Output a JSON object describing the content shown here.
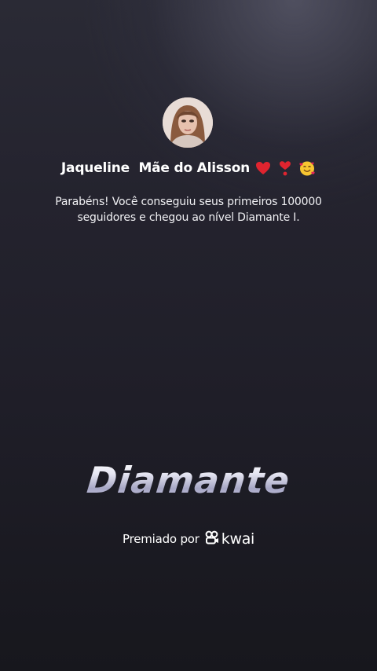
{
  "profile": {
    "name": "Jaqueline  Mãe do Alisson",
    "name_emojis": [
      "red-heart",
      "heart-exclamation",
      "smiling-face-with-hearts"
    ]
  },
  "message": {
    "line1": "Parabéns! Você conseguiu seus primeiros 100000",
    "line2": "seguidores e chegou ao nível Diamante I."
  },
  "level": {
    "title": "Diamante"
  },
  "award": {
    "prefix": "Premiado por",
    "brand": "kwai",
    "brand_icon": "kwai-logo-icon"
  },
  "colors": {
    "background_top": "#2a2a35",
    "background_bottom": "#17171d",
    "heart_red": "#e0242f",
    "text": "#ffffff"
  }
}
